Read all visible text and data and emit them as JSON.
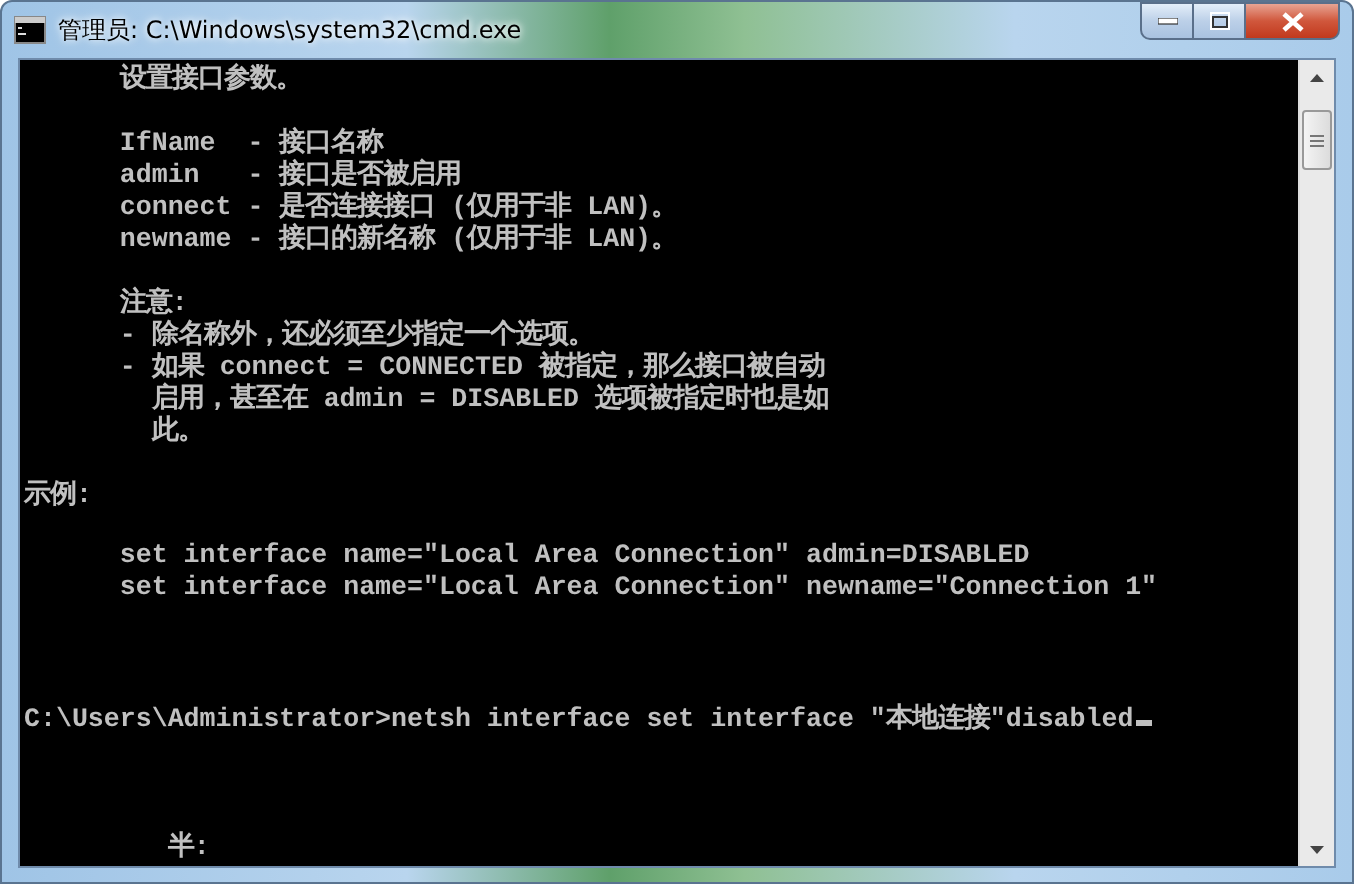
{
  "window": {
    "title": "管理员: C:\\Windows\\system32\\cmd.exe"
  },
  "console": {
    "lines": [
      {
        "kind": "text",
        "text": "      设置接口参数。"
      },
      {
        "kind": "blank"
      },
      {
        "kind": "text",
        "text": "      IfName  - 接口名称"
      },
      {
        "kind": "text",
        "text": "      admin   - 接口是否被启用"
      },
      {
        "kind": "text",
        "text": "      connect - 是否连接接口 (仅用于非 LAN)。"
      },
      {
        "kind": "text",
        "text": "      newname - 接口的新名称 (仅用于非 LAN)。"
      },
      {
        "kind": "blank"
      },
      {
        "kind": "text",
        "text": "      注意:"
      },
      {
        "kind": "text",
        "text": "      - 除名称外，还必须至少指定一个选项。"
      },
      {
        "kind": "text",
        "text": "      - 如果 connect = CONNECTED 被指定，那么接口被自动"
      },
      {
        "kind": "text",
        "text": "        启用，甚至在 admin = DISABLED 选项被指定时也是如"
      },
      {
        "kind": "text",
        "text": "        此。"
      },
      {
        "kind": "blank"
      },
      {
        "kind": "text",
        "text": "示例:"
      },
      {
        "kind": "blank"
      },
      {
        "kind": "text",
        "text": "      set interface name=\"Local Area Connection\" admin=DISABLED"
      },
      {
        "kind": "text",
        "text": "      set interface name=\"Local Area Connection\" newname=\"Connection 1\""
      },
      {
        "kind": "blank"
      },
      {
        "kind": "blank"
      },
      {
        "kind": "blank"
      },
      {
        "kind": "prompt",
        "text": "C:\\Users\\Administrator>netsh interface set interface \"本地连接\"disabled"
      },
      {
        "kind": "blank"
      },
      {
        "kind": "blank"
      },
      {
        "kind": "blank"
      },
      {
        "kind": "text",
        "text": "         半:"
      }
    ]
  }
}
